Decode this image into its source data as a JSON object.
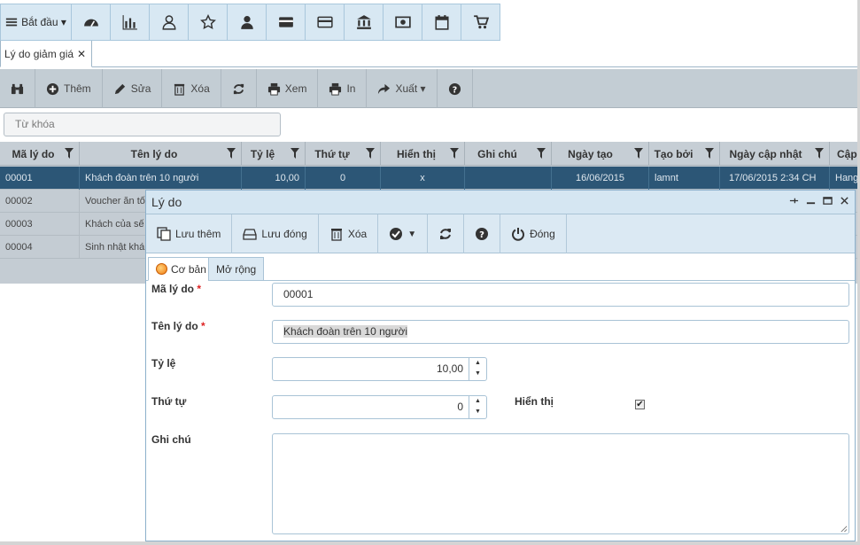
{
  "topbar": {
    "start_label": "Bắt đầu ▾"
  },
  "tab": {
    "label": "Lý do giảm giá",
    "close": "✕"
  },
  "grid_toolbar": {
    "add": "Thêm",
    "edit": "Sửa",
    "delete": "Xóa",
    "view": "Xem",
    "print": "In",
    "export": "Xuất ▾"
  },
  "search": {
    "placeholder": "Từ khóa"
  },
  "grid": {
    "columns": [
      "Mã lý do",
      "Tên lý do",
      "Tỷ lệ",
      "Thứ tự",
      "Hiển thị",
      "Ghi chú",
      "Ngày tạo",
      "Tạo bởi",
      "Ngày cập nhật",
      "Cập"
    ],
    "rows": [
      [
        "00001",
        "Khách đoàn trên 10 người",
        "10,00",
        "0",
        "x",
        "",
        "16/06/2015",
        "lamnt",
        "17/06/2015 2:34 CH",
        "Hangl"
      ],
      [
        "00002",
        "Voucher ăn tố",
        "",
        "",
        "",
        "",
        "",
        "",
        "",
        ""
      ],
      [
        "00003",
        "Khách của sế",
        "",
        "",
        "",
        "",
        "",
        "",
        "",
        ""
      ],
      [
        "00004",
        "Sinh nhật khá",
        "",
        "",
        "",
        "",
        "",
        "",
        "",
        ""
      ]
    ]
  },
  "dialog": {
    "title": "Lý do",
    "toolbar": {
      "save_new": "Lưu thêm",
      "save_close": "Lưu đóng",
      "delete": "Xóa",
      "close": "Đóng"
    },
    "tabs": {
      "basic": "Cơ bản",
      "extended": "Mở rộng"
    },
    "fields": {
      "code_label": "Mã lý do",
      "code_value": "00001",
      "name_label": "Tên lý do",
      "name_value": "Khách đoàn trên 10 người",
      "rate_label": "Tỷ lệ",
      "rate_value": "10,00",
      "order_label": "Thứ tự",
      "order_value": "0",
      "visible_label": "Hiển thị",
      "visible_checked": true,
      "note_label": "Ghi chú"
    },
    "required_mark": "*"
  }
}
